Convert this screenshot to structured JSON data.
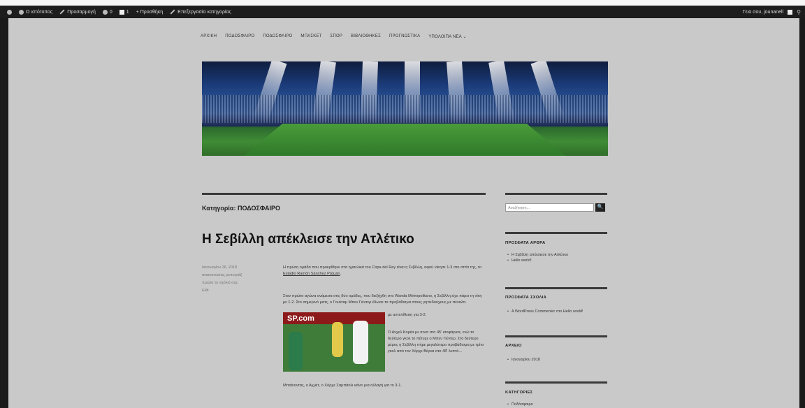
{
  "admin_bar": {
    "items": [
      "Ο ιστότοπος",
      "Προσαρμογή",
      "0",
      "1",
      "+ Προσθήκη",
      "Επεξεργασία κατηγορίας"
    ],
    "user": "Γεια σου, jounanell"
  },
  "nav": {
    "items": [
      "ΑΡΧΙΚΗ",
      "ΠΟΔΟΣΦΑΙΡΟ",
      "ΠΟΔΟΣΦΑΙΡΟ",
      "ΜΠΑΣΚΕΤ",
      "ΣΠΟΡ",
      "ΒΙΒΛΙΟΘΗΚΕΣ",
      "ΠΡΟΓΝΩΣΤΙΚΑ",
      "ΥΠΟΛΟΙΠΑ ΝΕΑ"
    ],
    "more": "⌄"
  },
  "category": {
    "label": "Κατηγορία:",
    "name": "ΠΟΔΟΣΦΑΙΡΟ"
  },
  "post": {
    "title": "Η Σεβίλλη απέκλεισε την Ατλέτικο",
    "meta": [
      "Ιανουαρίου 26, 2018",
      "ανακοινώσεις ρεπορτάζ",
      "πρώτα το σχόλιό σας",
      "Edit"
    ],
    "p1": "Η πρώτη ομάδα που προκρίθηκε στα ημιτελικά του Copa del Rey είναι η Σεβίλλη, αφού νίκησε 1-3 στο σπίτι της, το",
    "p1_link": "Estadio Ramón Sánchez Pizjuán",
    "p2": "Στον πρώτο αγώνα ανάμεσα στις δύο ομάδες, που διεξήχθη στο Wanda Metropolitano, η Σεβίλλη είχε πάρει τη νίκη με 1-2. Στο σημερινό ματς, ο Γουίσαμ Μπεν Γιέντερ έδωσε το προβάδισμα στους γηπεδούχους με πέναλτι.",
    "p2_end": "με αντεπίθεση για 3-2.",
    "p3": "Ο Ανχελ Κορέα με σουτ στο 45' ισοφάρισε, ενώ το δεύτερο γκολ το πέτυχε ο Μπεν Γιέντερ. Στο δεύτερο μέρος η Σεβίλλη πήρε μεγαλύτερο προβάδισμα με τρίτο γκολ από τον Χόρχε Βέγκα στο 48' λεπτό...",
    "p4": "Μπαίνοντας, ο Αχμέτ, ο Χόρχε Σαμπάολι κάνει μια αλλαγή για το 3-1.",
    "img_logo": "SP.com"
  },
  "sidebar": {
    "search_placeholder": "Αναζήτηση...",
    "search_button": "🔍",
    "recent_posts_title": "ΠΡΟΣΦΑΤΑ ΑΡΘΡΑ",
    "recent_posts": [
      "Η Σεβίλλη απέκλεισε την Ατλέτικο",
      "Hello world!"
    ],
    "recent_comments_title": "ΠΡΟΣΦΑΤΑ ΣΧΟΛΙΑ",
    "recent_comments": [
      "A WordPress Commenter στο Hello world!"
    ],
    "archives_title": "ΑΡΧΕΙΟ",
    "archives": [
      "Ιανουαρίου 2018"
    ],
    "categories_title": "ΚΑΤΗΓΟΡΙΕΣ",
    "categories": [
      "Ποδόσφαιρο"
    ]
  }
}
